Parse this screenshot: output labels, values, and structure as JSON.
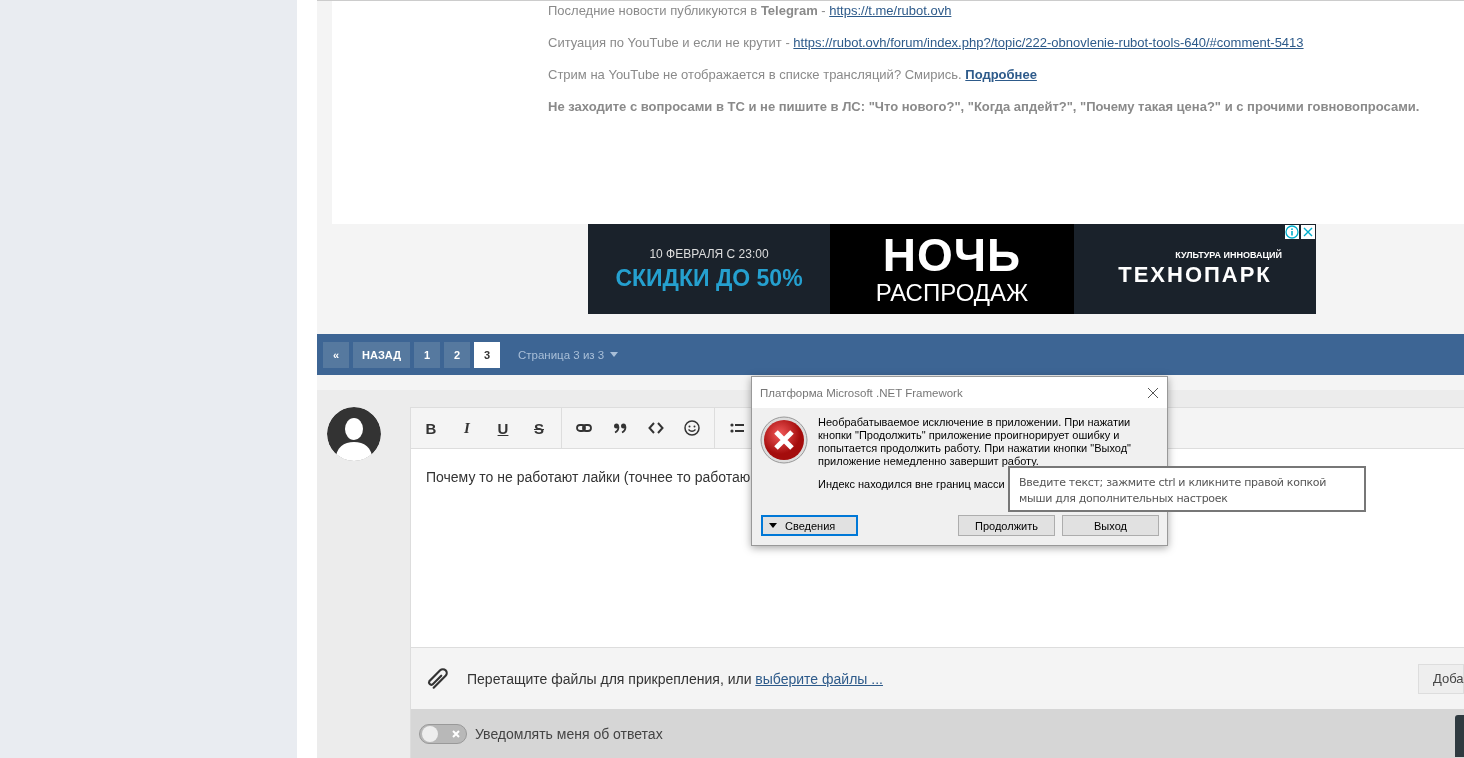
{
  "post": {
    "paragraphs": [
      {
        "kind": "text",
        "text": "Последние новости публикуются в **Telegram** - ",
        "link": "https://t.me/rubot.ovh"
      },
      {
        "kind": "text",
        "text": "Ситуация по YouTube и если не крутит - ",
        "link": "https://rubot.ovh/forum/index.php?/topic/222-obnovlenie-rubot-tools-640/#comment-5413"
      },
      {
        "kind": "text",
        "text": "Стрим на YouTube не отображается в списке трансляций? Смирись. ",
        "link": "Подробнее",
        "link_bold": true
      },
      {
        "kind": "bold",
        "text": "Не заходите с вопросами в ТС и не пишите в ЛС: \"Что нового?\", \"Когда апдейт?\", \"Почему такая цена?\" и с прочими говновопросами."
      }
    ]
  },
  "ad": {
    "date": "10 ФЕВРАЛЯ С 23:00",
    "offer": "СКИДКИ ДО 50%",
    "title": "НОЧЬ",
    "subtitle": "РАСПРОДАЖ",
    "tagline": "КУЛЬТУРА ИННОВАЦИЙ",
    "brand": "ТЕХНОПАРК"
  },
  "pagination": {
    "first": "«",
    "prev": "НАЗАД",
    "pages": [
      {
        "label": "1",
        "selected": false
      },
      {
        "label": "2",
        "selected": false
      },
      {
        "label": "3",
        "selected": true
      }
    ],
    "summary": "Страница 3 из 3"
  },
  "editor": {
    "toolbar": [
      {
        "kind": "bold",
        "label": "B"
      },
      {
        "kind": "italic",
        "label": "I"
      },
      {
        "kind": "underline",
        "label": "U"
      },
      {
        "kind": "strike",
        "label": "S"
      },
      {
        "kind": "sep"
      },
      {
        "kind": "link"
      },
      {
        "kind": "quote"
      },
      {
        "kind": "code"
      },
      {
        "kind": "emoji"
      },
      {
        "kind": "sep"
      },
      {
        "kind": "list"
      }
    ],
    "value": "Почему то не работают лайки (точнее то работаю",
    "attach_text": "Перетащите файлы для прикрепления, или ",
    "attach_link": "выберите файлы ...",
    "add_button": "Доба"
  },
  "notify": {
    "label": "Уведомлять меня об ответах",
    "on": false
  },
  "dialog": {
    "title": "Платформа Microsoft .NET Framework",
    "message": "Необрабатываемое исключение в приложении. При нажатии кнопки \"Продолжить\" приложение проигнорирует ошибку и попытается продолжить работу. При нажатии кнопки \"Выход\" приложение немедленно завершит работу.",
    "detail": "Индекс находился вне границ масси",
    "details_button": "Сведения",
    "buttons": [
      "Продолжить",
      "Выход"
    ]
  },
  "tooltip": {
    "text": "Введите текст; зажмите ctrl и кликните правой копкой мыши для дополнительных настроек"
  }
}
